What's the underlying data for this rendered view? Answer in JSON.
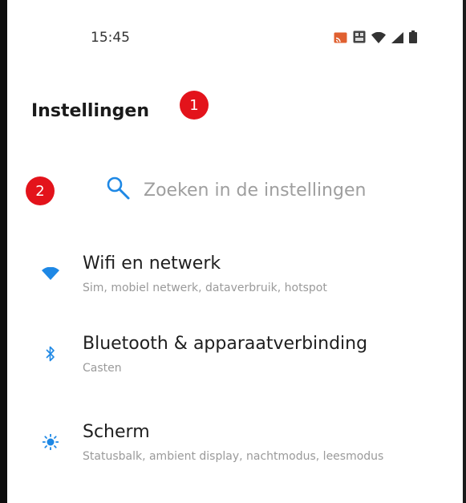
{
  "status_bar": {
    "time": "15:45",
    "icons": [
      "cast-icon",
      "volte-icon",
      "wifi-icon",
      "signal-icon",
      "battery-icon"
    ]
  },
  "header": {
    "title": "Instellingen"
  },
  "annotations": {
    "marker_1": "1",
    "marker_2": "2"
  },
  "search": {
    "placeholder": "Zoeken in de instellingen"
  },
  "colors": {
    "accent": "#1e88e5",
    "badge": "#e3131b"
  },
  "settings": [
    {
      "icon": "wifi-icon",
      "title": "Wifi en netwerk",
      "subtitle": "Sim, mobiel netwerk, dataverbruik, hotspot"
    },
    {
      "icon": "bluetooth-icon",
      "title": "Bluetooth & apparaatverbinding",
      "subtitle": "Casten"
    },
    {
      "icon": "brightness-icon",
      "title": "Scherm",
      "subtitle": "Statusbalk, ambient display, nachtmodus, leesmodus"
    }
  ]
}
